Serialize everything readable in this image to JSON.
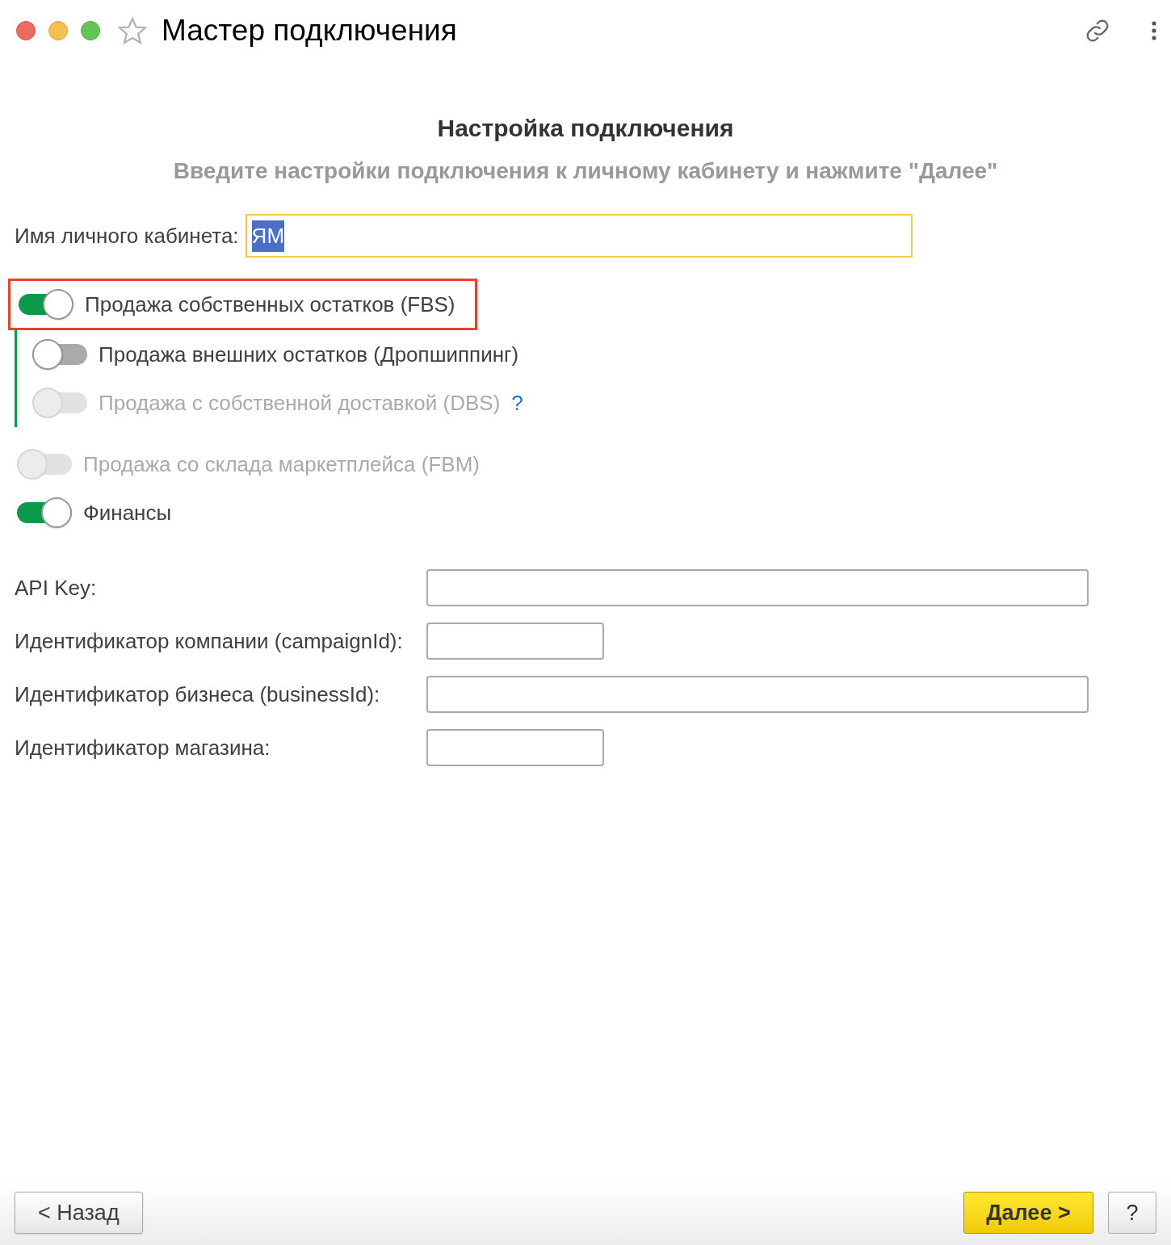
{
  "window": {
    "title": "Мастер подключения",
    "favorite": false
  },
  "heading": "Настройка подключения",
  "subheading": "Введите настройки подключения к личному кабинету и нажмите \"Далее\"",
  "account_name": {
    "label": "Имя личного кабинета:",
    "value": "ЯМ",
    "focused": true,
    "text_selected": true
  },
  "options": [
    {
      "label": "Продажа собственных остатков (FBS)",
      "on": true,
      "disabled": false,
      "highlighted": true,
      "children": [
        {
          "label": "Продажа внешних остатков (Дропшиппинг)",
          "on": false,
          "disabled": false,
          "highlighted": false
        },
        {
          "label": "Продажа с собственной доставкой (DBS)",
          "on": false,
          "disabled": true,
          "highlighted": false,
          "help": "?"
        }
      ]
    },
    {
      "label": "Продажа со склада маркетплейса (FBM)",
      "on": false,
      "disabled": true,
      "highlighted": false
    },
    {
      "label": "Финансы",
      "on": true,
      "disabled": false,
      "highlighted": false
    }
  ],
  "fields": [
    {
      "label": "API Key:",
      "wide": true
    },
    {
      "label": "Идентификатор компании (campaignId):",
      "wide": false
    },
    {
      "label": "Идентификатор бизнеса (businessId):",
      "wide": true
    },
    {
      "label": "Идентификатор магазина:",
      "wide": false
    }
  ],
  "footer": {
    "back": "< Назад",
    "next": "Далее >",
    "help": "?"
  }
}
